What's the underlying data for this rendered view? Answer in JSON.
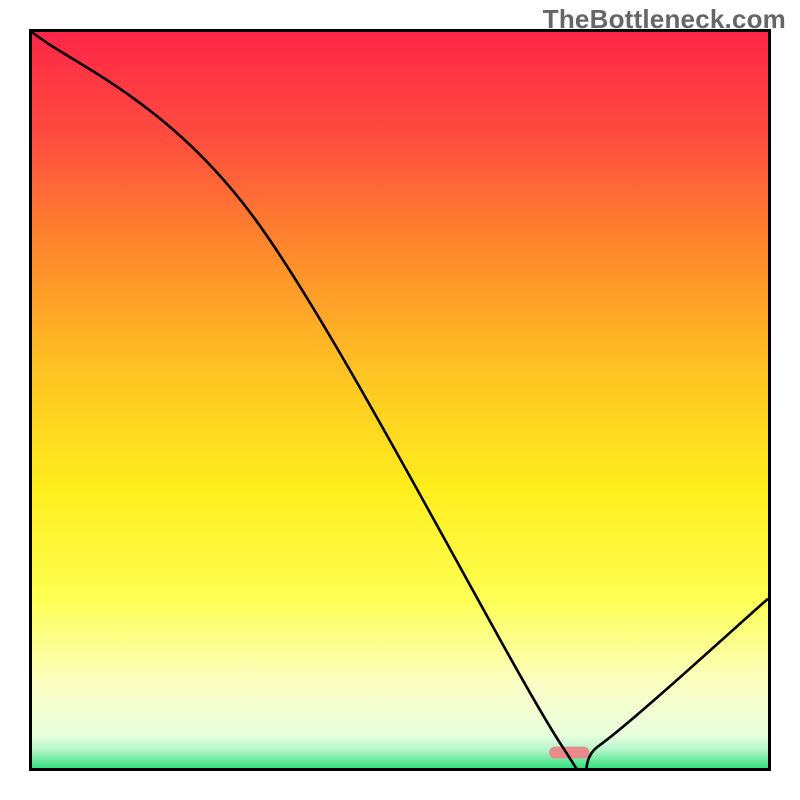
{
  "watermark": "TheBottleneck.com",
  "chart_data": {
    "type": "line",
    "title": "",
    "xlabel": "",
    "ylabel": "",
    "xlim": [
      0,
      100
    ],
    "ylim": [
      0,
      100
    ],
    "series": [
      {
        "name": "curve",
        "x": [
          0,
          30,
          72,
          77,
          100
        ],
        "values": [
          100,
          75,
          3,
          3,
          23
        ]
      }
    ],
    "marker": {
      "x_center": 73,
      "y": 2.1,
      "width_pct": 5.5,
      "height_pct": 1.6,
      "color": "#e98b8b",
      "radius_frac": 0.5
    },
    "background_gradient": {
      "direction": "top-to-bottom",
      "stops": [
        {
          "offset": 0.0,
          "color": "#ff2648"
        },
        {
          "offset": 0.14,
          "color": "#ff4c3f"
        },
        {
          "offset": 0.3,
          "color": "#ff8a2c"
        },
        {
          "offset": 0.46,
          "color": "#ffc223"
        },
        {
          "offset": 0.62,
          "color": "#ffee1e"
        },
        {
          "offset": 0.77,
          "color": "#fdff53"
        },
        {
          "offset": 0.89,
          "color": "#fbffc7"
        },
        {
          "offset": 0.955,
          "color": "#e9ffde"
        },
        {
          "offset": 0.975,
          "color": "#b7f5cb"
        },
        {
          "offset": 1.0,
          "color": "#31e07e"
        }
      ]
    },
    "frame_color": "#000000",
    "line_color": "#000000",
    "line_width": 2.6
  }
}
